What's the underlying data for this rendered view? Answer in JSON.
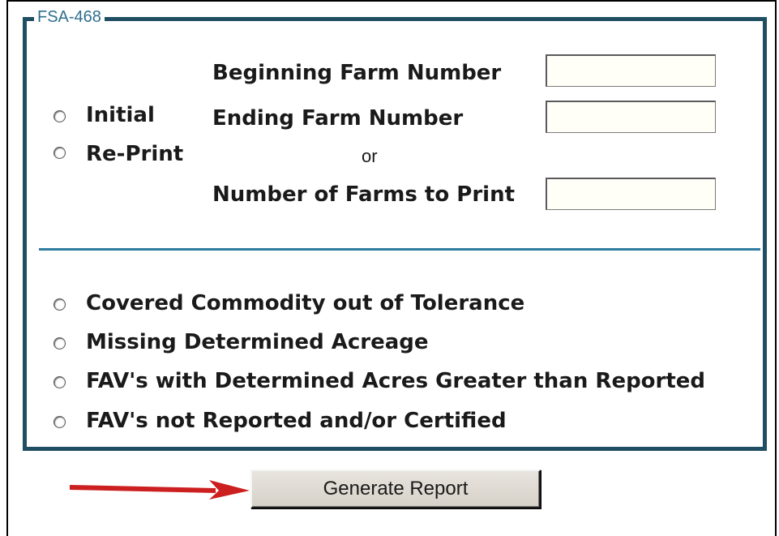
{
  "fieldset": {
    "legend": "FSA-468"
  },
  "print_mode": {
    "options": [
      {
        "label": "Initial",
        "selected": false
      },
      {
        "label": "Re-Print",
        "selected": false
      }
    ]
  },
  "farm_range": {
    "beginning_label": "Beginning Farm Number",
    "beginning_value": "",
    "ending_label": "Ending Farm Number",
    "ending_value": "",
    "or_text": "or",
    "count_label": "Number of Farms to Print",
    "count_value": ""
  },
  "report_types": {
    "options": [
      {
        "label": "Covered Commodity out of Tolerance",
        "selected": false
      },
      {
        "label": "Missing Determined Acreage",
        "selected": false
      },
      {
        "label": "FAV's with Determined Acres Greater than Reported",
        "selected": false
      },
      {
        "label": "FAV's not Reported and/or Certified",
        "selected": false
      }
    ]
  },
  "actions": {
    "generate_label": "Generate Report"
  },
  "colors": {
    "fieldset_border": "#1f4e62",
    "legend_text": "#2e6f8f",
    "divider": "#2e7ca0",
    "annotation_arrow": "#cc1f1f"
  },
  "icons": {
    "annotation": "arrow-right-icon"
  }
}
